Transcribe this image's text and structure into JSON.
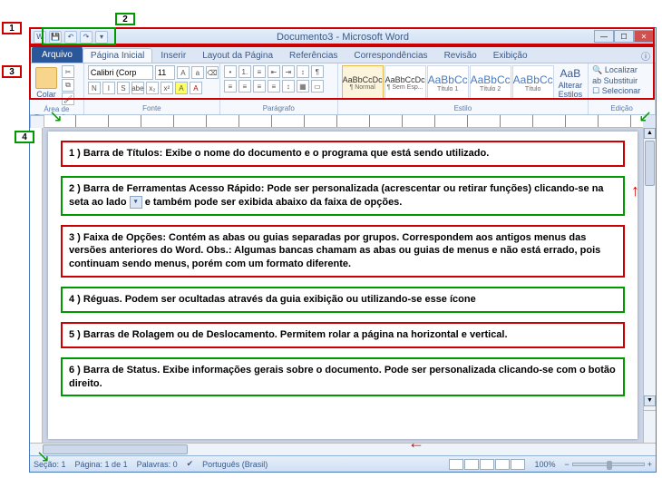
{
  "callouts": {
    "c1": "1",
    "c2": "2",
    "c3": "3",
    "c4": "4"
  },
  "title": "Documento3 - Microsoft Word",
  "tabs": {
    "file": "Arquivo",
    "home": "Página Inicial",
    "insert": "Inserir",
    "layout": "Layout da Página",
    "refs": "Referências",
    "mail": "Correspondências",
    "review": "Revisão",
    "view": "Exibição"
  },
  "ribbon": {
    "clipboard": {
      "paste": "Colar",
      "label": "Área de Transferência"
    },
    "font": {
      "family": "Calibri (Corp",
      "size": "11",
      "label": "Fonte",
      "bold": "N",
      "italic": "I",
      "under": "S",
      "strike": "abe",
      "sub": "x₂",
      "sup": "x²"
    },
    "paragraph": {
      "label": "Parágrafo"
    },
    "styles": {
      "label": "Estilo",
      "items": [
        {
          "sample": "AaBbCcDc",
          "name": "¶ Normal"
        },
        {
          "sample": "AaBbCcDc",
          "name": "¶ Sem Esp..."
        },
        {
          "sample": "AaBbCc",
          "name": "Título 1"
        },
        {
          "sample": "AaBbCc",
          "name": "Título 2"
        },
        {
          "sample": "AaBbCc",
          "name": "Título"
        }
      ],
      "change": "AaB",
      "changeLabel": "Alterar Estilos"
    },
    "editing": {
      "find": "Localizar",
      "replace": "Substituir",
      "select": "Selecionar",
      "label": "Edição"
    }
  },
  "boxes": {
    "b1": "1 ) Barra de Títulos: Exibe o nome do documento e o programa que está sendo utilizado.",
    "b2a": "2 ) Barra de Ferramentas Acesso Rápido: Pode ser personalizada (acrescentar ou retirar funções) clicando-se na seta ao lado ",
    "b2b": " e também pode ser exibida abaixo da faixa de opções.",
    "b3": "3 ) Faixa de Opções: Contém as abas ou guias separadas por grupos. Correspondem aos antigos menus das versões anteriores do Word.  Obs.: Algumas bancas chamam as abas ou guias de menus e não está errado, pois continuam sendo menus, porém com um formato diferente.",
    "b4": "4 ) Réguas. Podem ser ocultadas através da guia exibição ou utilizando-se esse ícone",
    "b5": "5 ) Barras de Rolagem ou de Deslocamento. Permitem rolar a página na horizontal e vertical.",
    "b6": "6 ) Barra de Status. Exibe informações gerais sobre o documento. Pode ser personalizada clicando-se com o botão direito."
  },
  "status": {
    "section": "Seção: 1",
    "page": "Página: 1 de 1",
    "words": "Palavras: 0",
    "lang": "Português (Brasil)",
    "zoom": "100%"
  }
}
